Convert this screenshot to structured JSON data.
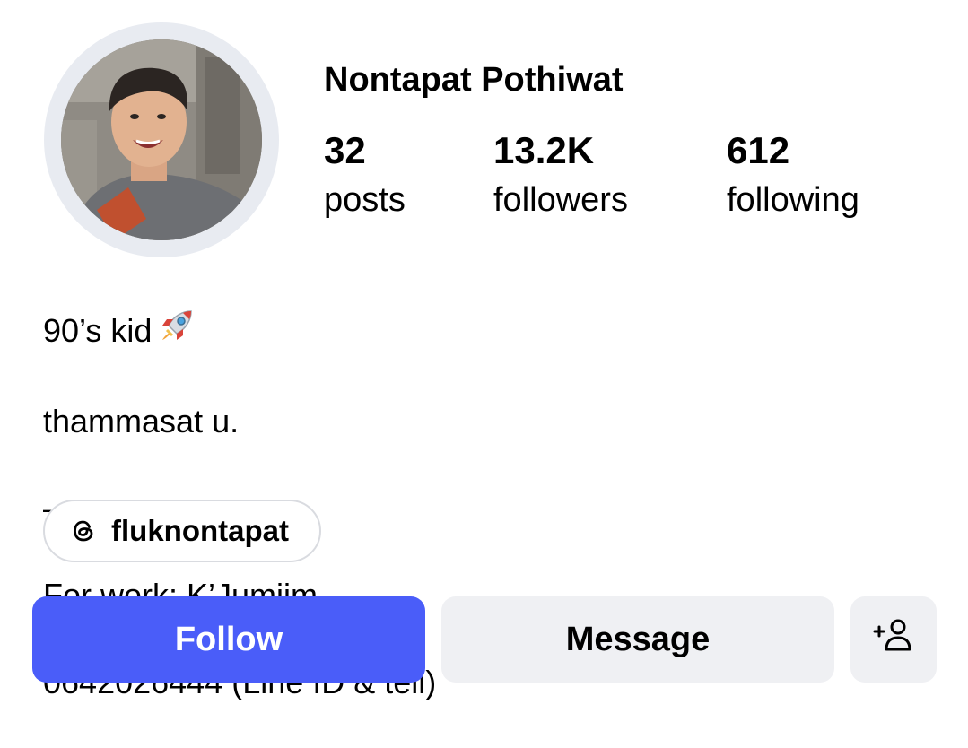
{
  "profile": {
    "username": "Nontapat Pothiwat",
    "avatar_alt": "profile photo"
  },
  "stats": {
    "posts": {
      "value": "32",
      "label": "posts"
    },
    "followers": {
      "value": "13.2K",
      "label": "followers"
    },
    "following": {
      "value": "612",
      "label": "following"
    }
  },
  "bio": {
    "line1": "90’s kid",
    "line1_emoji": "rocket-icon",
    "line2": "thammasat u.",
    "line3": "———",
    "line4": "For work: K’Jumjim",
    "line5": "0642026444 (Line ID & tell)"
  },
  "threads_link": {
    "icon": "threads-icon",
    "handle": "fluknontapat"
  },
  "actions": {
    "follow_label": "Follow",
    "message_label": "Message",
    "add_user_icon": "add-user-icon"
  },
  "colors": {
    "follow_button": "#4a5df9",
    "secondary_button": "#eff0f3",
    "avatar_ring": "#e8ebf1"
  }
}
